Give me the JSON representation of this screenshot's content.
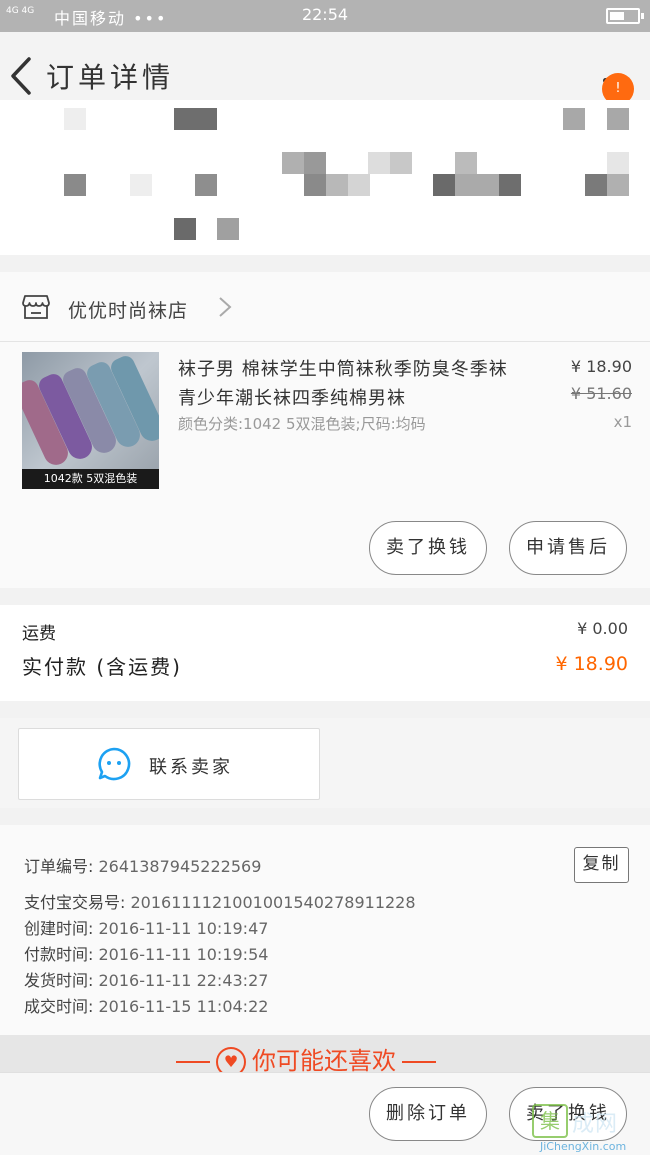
{
  "status_bar": {
    "network": "4G 4G",
    "carrier": "中国移动 •••",
    "time": "22:54",
    "battery_level": 0.55
  },
  "header": {
    "title": "订单详情",
    "badge": "!"
  },
  "shop": {
    "name": "优优时尚袜店"
  },
  "product": {
    "image_caption": "1042款 5双混色装",
    "title": "袜子男 棉袜学生中筒袜秋季防臭冬季袜青少年潮长袜四季纯棉男袜",
    "spec": "颜色分类:1042 5双混色装;尺码:均码",
    "price": "¥ 18.90",
    "original_price": "¥ 51.60",
    "quantity": "x1"
  },
  "actions": {
    "sell_button": "卖了换钱",
    "after_sale_button": "申请售后"
  },
  "summary": {
    "shipping_label": "运费",
    "shipping_value": "¥ 0.00",
    "paid_label": "实付款 (含运费)",
    "paid_value": "¥ 18.90"
  },
  "contact": {
    "label": "联系卖家"
  },
  "order_info": {
    "order_no_label": "订单编号:",
    "order_no": "2641387945222569",
    "alipay_label": "支付宝交易号:",
    "alipay_no": "2016111121001001540278911228",
    "created_label": "创建时间:",
    "created": "2016-11-11 10:19:47",
    "paid_label": "付款时间:",
    "paid": "2016-11-11 10:19:54",
    "shipped_label": "发货时间:",
    "shipped": "2016-11-11 22:43:27",
    "completed_label": "成交时间:",
    "completed": "2016-11-15 11:04:22",
    "copy_button": "复制"
  },
  "recommend": {
    "text": "你可能还喜欢"
  },
  "bottom_bar": {
    "delete_button": "删除订单",
    "sell_button": "卖了换钱"
  },
  "watermark": {
    "logo": "集",
    "text": "成网",
    "url": "JiChengXin.com"
  },
  "colors": {
    "accent": "#ff6600",
    "badge": "#ff6a10",
    "recommend": "#ef4a23",
    "contact_icon": "#1da1f2"
  }
}
